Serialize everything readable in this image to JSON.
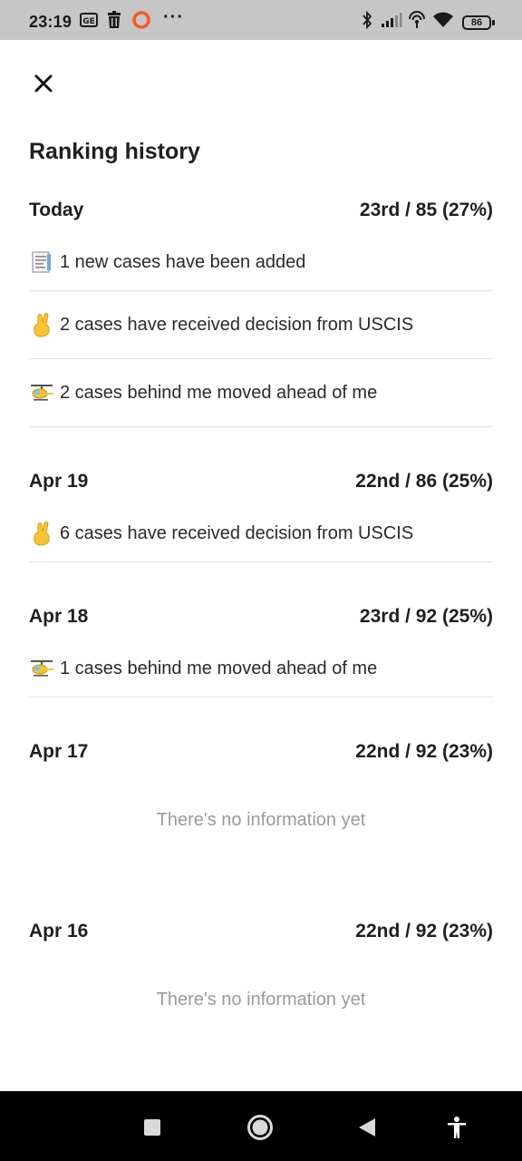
{
  "status_bar": {
    "time": "23:19",
    "battery": "86",
    "icons": [
      "ge-icon",
      "trash-icon",
      "record-icon",
      "bluetooth-icon",
      "signal-icon",
      "hotspot-icon",
      "wifi-icon",
      "battery-icon"
    ]
  },
  "header": {
    "close_icon": "close-icon",
    "title": "Ranking history"
  },
  "days": [
    {
      "date": "Today",
      "rank": "23rd / 85 (27%)",
      "events": [
        {
          "icon": "document-emoji",
          "text": "1 new cases have been added"
        },
        {
          "icon": "crossed-fingers-emoji",
          "text": "2 cases have received decision from USCIS"
        },
        {
          "icon": "helicopter-emoji",
          "text": "2 cases behind me moved ahead of me"
        }
      ]
    },
    {
      "date": "Apr 19",
      "rank": "22nd / 86 (25%)",
      "events": [
        {
          "icon": "crossed-fingers-emoji",
          "text": "6 cases have received decision from USCIS"
        }
      ]
    },
    {
      "date": "Apr 18",
      "rank": "23rd / 92 (25%)",
      "events": [
        {
          "icon": "helicopter-emoji",
          "text": "1 cases behind me moved ahead of me"
        }
      ]
    },
    {
      "date": "Apr 17",
      "rank": "22nd / 92 (23%)",
      "empty_text": "There's no information yet"
    },
    {
      "date": "Apr 16",
      "rank": "22nd / 92 (23%)",
      "empty_text": "There's no information yet"
    }
  ],
  "nav_bar": {
    "buttons": [
      "recents-button",
      "home-button",
      "back-button",
      "accessibility-button"
    ]
  },
  "colors": {
    "status_bar_bg": "#c6c6c6",
    "text": "#1f1f1f",
    "muted": "#9a9a9a",
    "divider": "#e2e2e2",
    "nav_bg": "#000000"
  }
}
